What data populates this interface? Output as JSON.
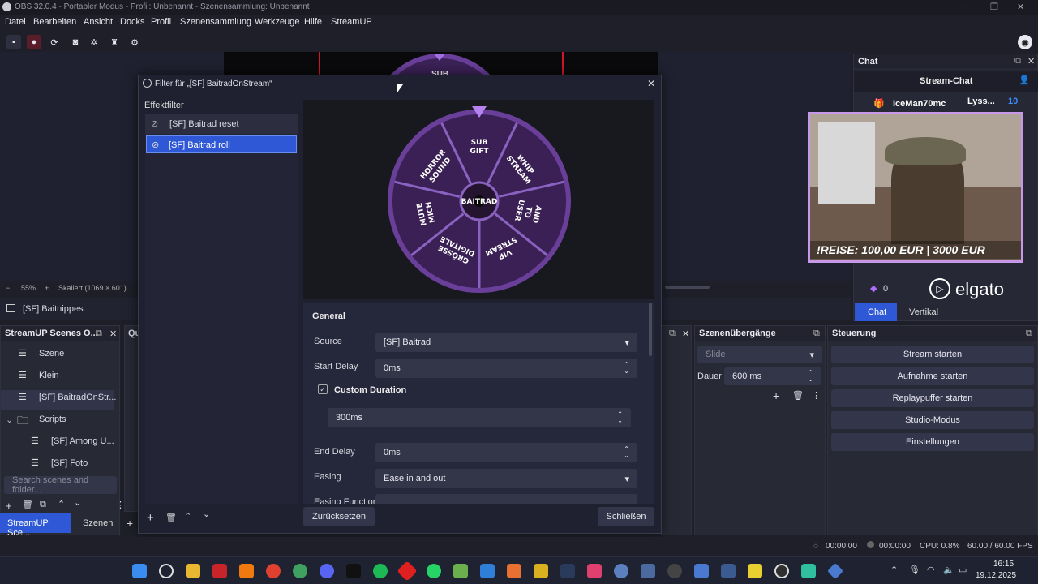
{
  "window": {
    "title": "OBS 32.0.4 - Portabler Modus - Profil: Unbenannt - Szenensammlung: Unbenannt"
  },
  "menu": [
    "Datei",
    "Bearbeiten",
    "Ansicht",
    "Docks",
    "Profil",
    "Szenensammlung",
    "Werkzeuge",
    "Hilfe",
    "StreamUP"
  ],
  "preview": {
    "zoom": "55%",
    "scale": "Skaliert (1069 × 601)",
    "wheel_top_label": "SUB"
  },
  "source_bar": {
    "label": "[SF] Baitnippes"
  },
  "dialog": {
    "title": "Filter für „[SF] BaitradOnStream“",
    "effect_filters_label": "Effektfilter",
    "filters": [
      {
        "name": "[SF] Baitrad reset",
        "selected": false
      },
      {
        "name": "[SF] Baitrad roll",
        "selected": true
      }
    ],
    "wheel": {
      "center": "BAITRAD",
      "segments": [
        "SUB GIFT",
        "WHIP STREAM",
        "AND TO USER",
        "VIP STREAM",
        "GRÖSSE DIGITALE",
        "MUTE MICH",
        "HORROR SOUND"
      ]
    },
    "general_label": "General",
    "source_label": "Source",
    "source_value": "[SF] Baitrad",
    "start_delay_label": "Start Delay",
    "start_delay_value": "0ms",
    "custom_duration_label": "Custom Duration",
    "custom_duration_checked": true,
    "custom_duration_value": "300ms",
    "end_delay_label": "End Delay",
    "end_delay_value": "0ms",
    "easing_label": "Easing",
    "easing_value": "Ease in and out",
    "easing_function_label": "Easing Function",
    "reset_button": "Zurücksetzen",
    "close_button": "Schließen"
  },
  "chat": {
    "dock_title": "Chat",
    "header": "Stream-Chat",
    "user": "IceMan70mc",
    "user2": "Lyss...",
    "count": "10",
    "tabs": [
      "Chat",
      "Vertikal"
    ],
    "reward_count": "0"
  },
  "webcam": {
    "overlay_text": "!REISE: 100,00 EUR | 3000 EUR",
    "brand": "elgato"
  },
  "scenes_dock": {
    "title": "StreamUP Scenes O...",
    "items": [
      {
        "label": "Szene",
        "indent": 0
      },
      {
        "label": "Klein",
        "indent": 0
      },
      {
        "label": "[SF] BaitradOnStr...",
        "indent": 0
      },
      {
        "label": "Scripts",
        "indent": 0,
        "folder": true
      },
      {
        "label": "[SF] Among U...",
        "indent": 1
      },
      {
        "label": "[SF] Foto",
        "indent": 1
      }
    ],
    "search_placeholder": "Search scenes and folder..."
  },
  "bottom_tabs": [
    "StreamUP Sce...",
    "Szenen"
  ],
  "qu_dock": {
    "title": "Qu"
  },
  "transitions": {
    "title": "Szenenübergänge",
    "select": "Slide",
    "duration_label": "Dauer",
    "duration_value": "600 ms"
  },
  "controls": {
    "title": "Steuerung",
    "buttons": [
      "Stream starten",
      "Aufnahme starten",
      "Replaypuffer starten",
      "Studio-Modus",
      "Einstellungen"
    ]
  },
  "status": {
    "stream_time": "00:00:00",
    "rec_time": "00:00:00",
    "cpu": "CPU: 0.8%",
    "fps": "60.00 / 60.00 FPS"
  },
  "clock": {
    "time": "16:15",
    "date": "19.12.2025"
  }
}
